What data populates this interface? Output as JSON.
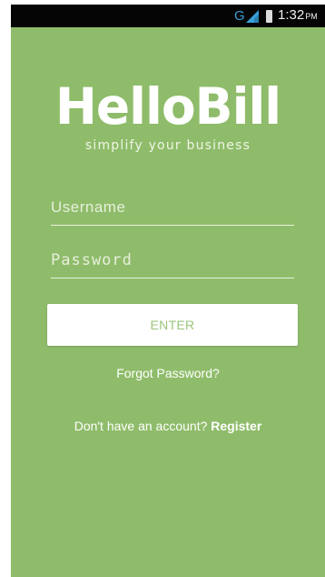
{
  "statusbar": {
    "network": "G",
    "time": "1:32",
    "ampm": "PM",
    "network_color": "#3aa0d8"
  },
  "brand": {
    "logo": "HelloBill",
    "tagline": "simplify your business"
  },
  "form": {
    "username_placeholder": "Username",
    "password_placeholder": "Password",
    "enter_label": "ENTER",
    "forgot_label": "Forgot Password?",
    "no_account_text": "Don't have an account? ",
    "register_label": "Register"
  },
  "colors": {
    "background": "#8fbc6a",
    "button": "#ffffff",
    "button_text": "#9cc57c"
  }
}
